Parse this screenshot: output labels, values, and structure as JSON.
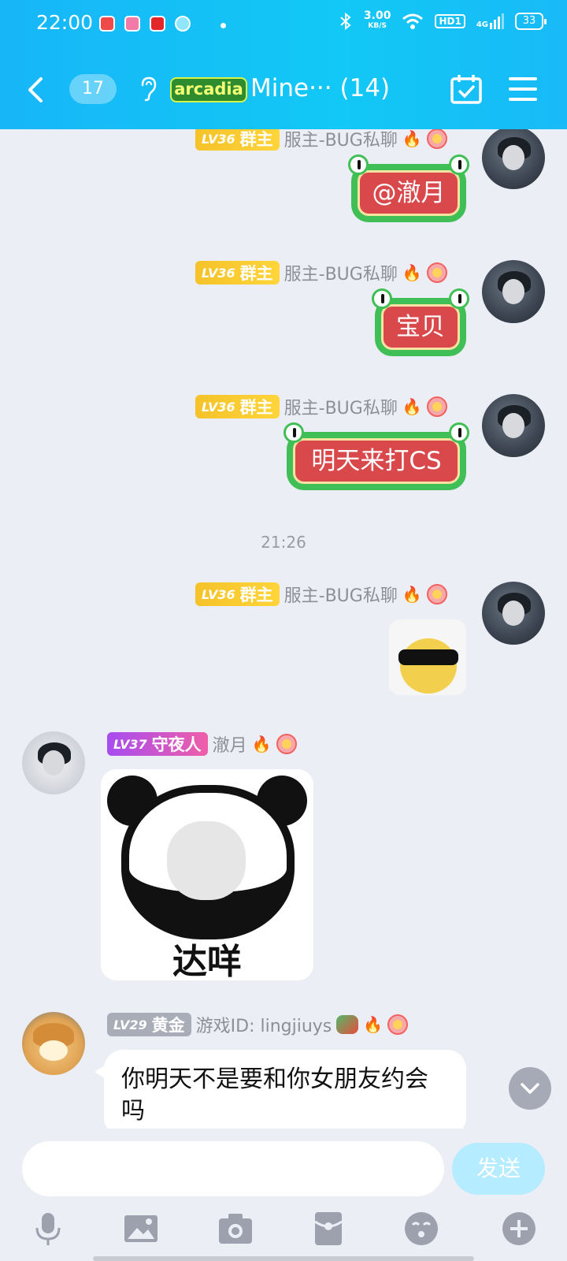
{
  "status_bar": {
    "time": "22:00",
    "net_speed": "3.00",
    "net_unit": "KB/S",
    "hd": "HD1",
    "signal": "4G",
    "battery": "33"
  },
  "header": {
    "unread_count": "17",
    "group_title": "Mine··· (14)",
    "logo_text": "arcadia"
  },
  "messages": [
    {
      "level": "LV36",
      "role": "群主",
      "sender": "服主-BUG私聊",
      "text": "@澈月"
    },
    {
      "level": "LV36",
      "role": "群主",
      "sender": "服主-BUG私聊",
      "text": "宝贝"
    },
    {
      "level": "LV36",
      "role": "群主",
      "sender": "服主-BUG私聊",
      "text": "明天来打CS"
    },
    {
      "level": "LV36",
      "role": "群主",
      "sender": "服主-BUG私聊",
      "sticker": "sunglasses-duck"
    },
    {
      "level": "LV37",
      "role": "守夜人",
      "sender": "澈月",
      "sticker_text": "达咩"
    },
    {
      "level": "LV29",
      "role": "黄金",
      "sender": "游戏ID: lingjiuys",
      "text": "你明天不是要和你女朋友约会吗"
    }
  ],
  "timestamp": "21:26",
  "input": {
    "value": "",
    "send_label": "发送"
  },
  "colors": {
    "header": "#17b6f7",
    "background": "#eceef5",
    "frog_green": "#3fbf55",
    "frog_red": "#d9484a",
    "gold_badge": "#f5c22a"
  }
}
